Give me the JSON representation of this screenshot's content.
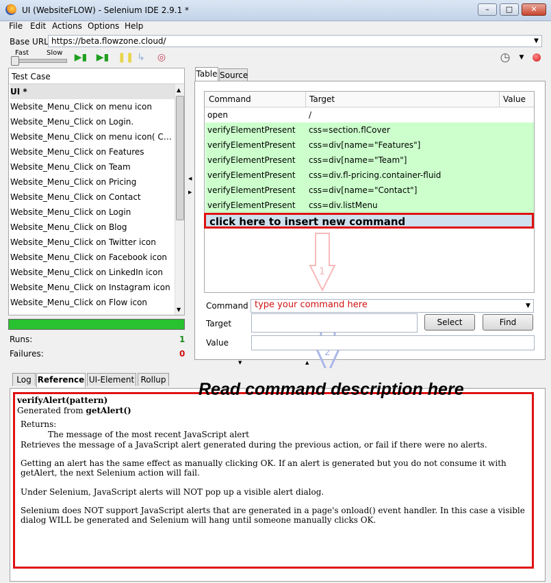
{
  "window": {
    "title": "UI (WebsiteFLOW) - Selenium IDE 2.9.1 *",
    "controls": {
      "minimize": "–",
      "maximize": "□",
      "close": "✕"
    }
  },
  "menu": [
    "File",
    "Edit",
    "Actions",
    "Options",
    "Help"
  ],
  "base_url": {
    "label": "Base URL",
    "value": "https://beta.flowzone.cloud/"
  },
  "toolbar": {
    "fast_label": "Fast",
    "slow_label": "Slow"
  },
  "test_case": {
    "header": "Test Case",
    "items": [
      "UI *",
      "Website_Menu_Click on menu icon",
      "Website_Menu_Click on Login.",
      "Website_Menu_Click on menu icon( Color ...",
      "Website_Menu_Click on Features",
      "Website_Menu_Click on Team",
      "Website_Menu_Click on Pricing",
      "Website_Menu_Click on Contact",
      "Website_Menu_Click on Login",
      "Website_Menu_Click on Blog",
      "Website_Menu_Click on Twitter icon",
      "Website_Menu_Click on Facebook icon",
      "Website_Menu_Click on LinkedIn icon",
      "Website_Menu_Click on Instagram icon",
      "Website_Menu_Click on Flow icon"
    ]
  },
  "stats": {
    "runs_label": "Runs:",
    "runs": "1",
    "failures_label": "Failures:",
    "failures": "0"
  },
  "editor_tabs": [
    "Table",
    "Source"
  ],
  "table": {
    "headers": [
      "Command",
      "Target",
      "Value"
    ],
    "rows": [
      {
        "command": "open",
        "target": "/",
        "value": ""
      },
      {
        "command": "verifyElementPresent",
        "target": "css=section.flCover",
        "value": ""
      },
      {
        "command": "verifyElementPresent",
        "target": "css=div[name=\"Features\"]",
        "value": ""
      },
      {
        "command": "verifyElementPresent",
        "target": "css=div[name=\"Team\"]",
        "value": ""
      },
      {
        "command": "verifyElementPresent",
        "target": "css=div.fl-pricing.container-fluid",
        "value": ""
      },
      {
        "command": "verifyElementPresent",
        "target": "css=div[name=\"Contact\"]",
        "value": ""
      },
      {
        "command": "verifyElementPresent",
        "target": "css=div.listMenu",
        "value": ""
      }
    ],
    "insert_hint": "click here to insert new command"
  },
  "form": {
    "command_label": "Command",
    "command_hint": "type your command here",
    "target_label": "Target",
    "value_label": "Value",
    "select_button": "Select",
    "find_button": "Find"
  },
  "annotations": {
    "step1": "1",
    "step2": "2",
    "read_desc": "Read command description here"
  },
  "bottom_tabs": [
    "Log",
    "Reference",
    "UI-Element",
    "Rollup"
  ],
  "reference": {
    "signature": "verifyAlert(pattern)",
    "generated_prefix": "Generated from ",
    "generated_from": "getAlert()",
    "returns_label": "Returns:",
    "returns_text": "The message of the most recent JavaScript alert",
    "paragraphs": [
      "Retrieves the message of a JavaScript alert generated during the previous action, or fail if there were no alerts.",
      "Getting an alert has the same effect as manually clicking OK. If an alert is generated but you do not consume it with getAlert, the next Selenium action will fail.",
      "Under Selenium, JavaScript alerts will NOT pop up a visible alert dialog.",
      "Selenium does NOT support JavaScript alerts that are generated in a page's onload() event handler. In this case a visible dialog WILL be generated and Selenium will hang until someone manually clicks OK."
    ]
  },
  "colors": {
    "row_highlight": "#ccffcc",
    "annotation_red": "#e01010",
    "progress_green": "#29c12f"
  }
}
